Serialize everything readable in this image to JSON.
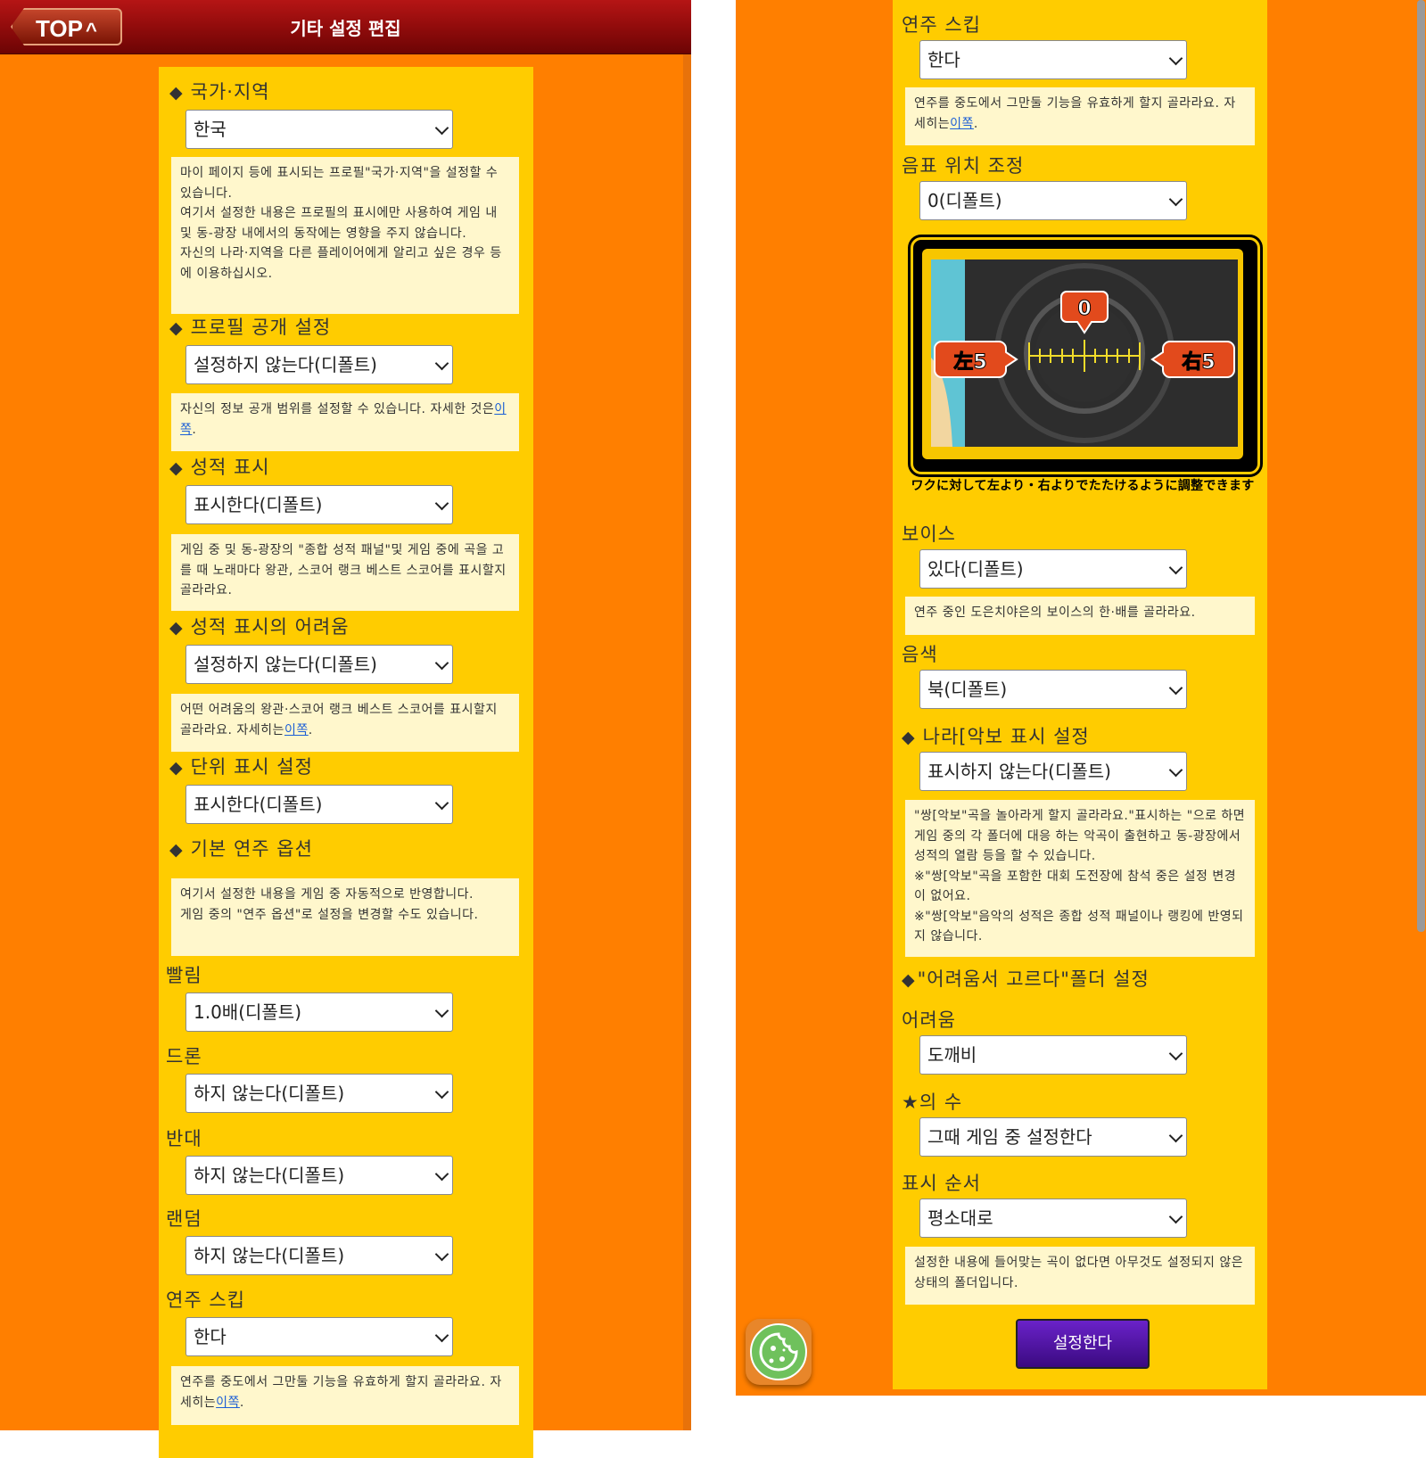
{
  "header": {
    "top_label": "TOP",
    "top_caret": "^",
    "title": "기타 설정 편집"
  },
  "diamond": "◆",
  "left": {
    "country": {
      "label": "국가·지역",
      "value": "한국",
      "note": "마이 페이지 등에 표시되는 프로필\"국가·지역\"을 설정할 수 있습니다.\n여기서 설정한 내용은 프로필의 표시에만 사용하여 게임 내 및 동-광장 내에서의 동작에는 영향을 주지 않습니다.\n자신의 나라·지역을 다른 플레이어에게 알리고 싶은 경우 등에 이용하십시오."
    },
    "profile": {
      "label": "프로필 공개 설정",
      "value": "설정하지 않는다(디폴트)",
      "note": "자신의 정보 공개 범위를 설정할 수 있습니다. 자세한 것은",
      "link": "이쪽",
      "end": "."
    },
    "score_display": {
      "label": "성적 표시",
      "value": "표시한다(디폴트)",
      "note": "게임 중 및 동-광장의 \"종합 성적 패널\"및 게임 중에 곡을 고를 때 노래마다 왕관, 스코어 랭크 베스트 스코어를 표시할지 골라라요."
    },
    "score_difficulty": {
      "label": "성적 표시의 어려움",
      "value": "설정하지 않는다(디폴트)",
      "note": "어떤 어려움의 왕관·스코어 랭크 베스트 스코어를 표시할지 골라라요. 자세히는",
      "link": "이쪽",
      "end": "."
    },
    "unit": {
      "label": "단위 표시 설정",
      "value": "표시한다(디폴트)"
    },
    "basic": {
      "label": "기본 연주 옵션",
      "note": "여기서 설정한 내용을 게임 중 자동적으로 반영합니다.\n게임 중의 \"연주 옵션\"로 설정을 변경할 수도 있습니다."
    },
    "speed": {
      "label": "빨림",
      "value": "1.0배(디폴트)"
    },
    "doron": {
      "label": "드론",
      "value": "하지 않는다(디폴트)"
    },
    "reverse": {
      "label": "반대",
      "value": "하지 않는다(디폴트)"
    },
    "random": {
      "label": "랜덤",
      "value": "하지 않는다(디폴트)"
    },
    "skip": {
      "label": "연주 스킵",
      "value": "한다",
      "note": "연주를 중도에서 그만둘 기능을 유효하게 할지 골라라요. 자세히는",
      "link": "이쪽",
      "end": "."
    }
  },
  "right": {
    "skip": {
      "label": "연주 스킵",
      "value": "한다",
      "note": "연주를 중도에서 그만둘 기능을 유효하게 할지 골라라요. 자세히는",
      "link": "이쪽",
      "end": "."
    },
    "note_pos": {
      "label": "음표 위치 조정",
      "value": "0(디폴트)"
    },
    "image": {
      "center": "0",
      "left": "左5",
      "right": "右5",
      "caption": "ワクに対して左より・右よりでたたけるように調整できます"
    },
    "voice": {
      "label": "보이스",
      "value": "있다(디폴트)",
      "note": "연주 중인 도은치야은의 보이스의 한·배를 골라라요."
    },
    "tone": {
      "label": "음색",
      "value": "북(디폴트)"
    },
    "twin": {
      "label": "나라[악보 표시 설정",
      "value": "표시하지 않는다(디폴트)",
      "note": "\"쌍[악보\"곡을 놀아라게 할지 골라라요.\"표시하는 \"으로 하면 게임 중의 각 폴더에 대응 하는 악곡이 출현하고 동-광장에서 성적의 열람 등을 할 수 있습니다.\n※\"쌍[악보\"곡을 포함한 대회 도전장에 참석 중은 설정 변경이 없어요.\n※\"쌍[악보\"음악의 성적은 종합 성적 패널이나 랭킹에 반영되지 않습니다."
    },
    "folder": {
      "label": "\"어려움서 고르다\"폴더 설정"
    },
    "difficulty": {
      "label": "어려움",
      "value": "도깨비"
    },
    "stars": {
      "label": "★의 수",
      "value": "그때 게임 중 설정한다"
    },
    "order": {
      "label": "표시 순서",
      "value": "평소대로",
      "note": "설정한 내용에 들어맞는 곡이 없다면 아무것도 설정되지 않은 상태의 폴더입니다."
    },
    "submit": "설정한다"
  },
  "colors": {
    "background": "#ff7f00",
    "panel": "#ffcc00",
    "note_bg": "#fff7cc",
    "submit": "#4b139f"
  },
  "icons": {
    "back": "chevron-up-icon",
    "cookie": "cookie-icon",
    "select": "chevron-down-icon"
  }
}
